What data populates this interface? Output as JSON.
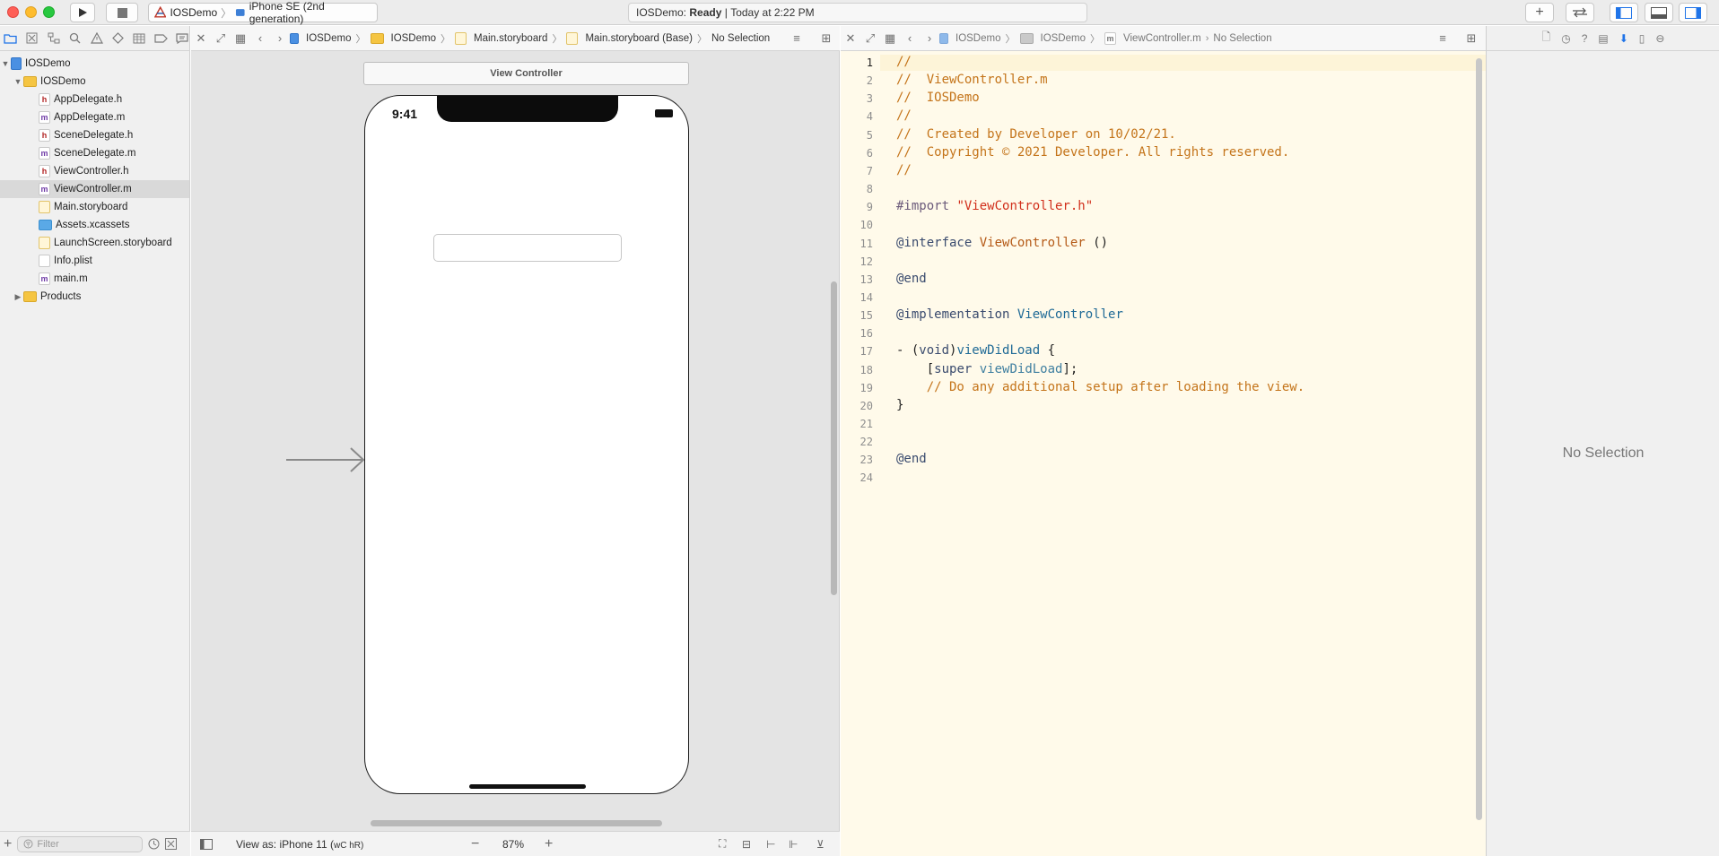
{
  "toolbar": {
    "scheme_project": "IOSDemo",
    "scheme_device": "iPhone SE (2nd generation)",
    "status_prefix": "IOSDemo:",
    "status_state": "Ready",
    "status_time": "Today at 2:22 PM"
  },
  "navigator": {
    "root": "IOSDemo",
    "group": "IOSDemo",
    "files": [
      {
        "name": "AppDelegate.h",
        "kind": "h"
      },
      {
        "name": "AppDelegate.m",
        "kind": "m"
      },
      {
        "name": "SceneDelegate.h",
        "kind": "h"
      },
      {
        "name": "SceneDelegate.m",
        "kind": "m"
      },
      {
        "name": "ViewController.h",
        "kind": "h"
      },
      {
        "name": "ViewController.m",
        "kind": "m",
        "selected": true
      },
      {
        "name": "Main.storyboard",
        "kind": "storyboard"
      },
      {
        "name": "Assets.xcassets",
        "kind": "assets"
      },
      {
        "name": "LaunchScreen.storyboard",
        "kind": "storyboard"
      },
      {
        "name": "Info.plist",
        "kind": "plist"
      },
      {
        "name": "main.m",
        "kind": "m"
      }
    ],
    "products": "Products",
    "filter_placeholder": "Filter"
  },
  "ib": {
    "breadcrumbs": [
      "IOSDemo",
      "IOSDemo",
      "Main.storyboard",
      "Main.storyboard (Base)",
      "No Selection"
    ],
    "scene_title": "View Controller",
    "device_time": "9:41",
    "view_as_label": "View as: iPhone 11 (",
    "view_as_size": "wC hR)",
    "zoom": "87%"
  },
  "code": {
    "breadcrumbs": [
      "IOSDemo",
      "IOSDemo",
      "ViewController.m",
      "No Selection"
    ],
    "current_line": 1,
    "lines": [
      [
        {
          "t": "//",
          "c": "comment"
        }
      ],
      [
        {
          "t": "//  ViewController.m",
          "c": "comment"
        }
      ],
      [
        {
          "t": "//  IOSDemo",
          "c": "comment"
        }
      ],
      [
        {
          "t": "//",
          "c": "comment"
        }
      ],
      [
        {
          "t": "//  Created by Developer on 10/02/21.",
          "c": "comment"
        }
      ],
      [
        {
          "t": "//  Copyright © 2021 Developer. All rights reserved.",
          "c": "comment"
        }
      ],
      [
        {
          "t": "//",
          "c": "comment"
        }
      ],
      [],
      [
        {
          "t": "#import ",
          "c": "preproc"
        },
        {
          "t": "\"ViewController.h\"",
          "c": "string"
        }
      ],
      [],
      [
        {
          "t": "@interface",
          "c": "keyword"
        },
        {
          "t": " ",
          "c": "plain"
        },
        {
          "t": "ViewController",
          "c": "type"
        },
        {
          "t": " ()",
          "c": "plain"
        }
      ],
      [],
      [
        {
          "t": "@end",
          "c": "keyword"
        }
      ],
      [],
      [
        {
          "t": "@implementation",
          "c": "keyword"
        },
        {
          "t": " ",
          "c": "plain"
        },
        {
          "t": "ViewController",
          "c": "typedecl"
        }
      ],
      [],
      [
        {
          "t": "- (",
          "c": "plain"
        },
        {
          "t": "void",
          "c": "keyword"
        },
        {
          "t": ")",
          "c": "plain"
        },
        {
          "t": "viewDidLoad",
          "c": "method"
        },
        {
          "t": " {",
          "c": "plain"
        }
      ],
      [
        {
          "t": "    [",
          "c": "plain"
        },
        {
          "t": "super",
          "c": "keyword"
        },
        {
          "t": " ",
          "c": "plain"
        },
        {
          "t": "viewDidLoad",
          "c": "methodcall"
        },
        {
          "t": "];",
          "c": "plain"
        }
      ],
      [
        {
          "t": "    // Do any additional setup after loading the view.",
          "c": "comment"
        }
      ],
      [
        {
          "t": "}",
          "c": "plain"
        }
      ],
      [],
      [],
      [
        {
          "t": "@end",
          "c": "keyword"
        }
      ],
      []
    ]
  },
  "inspector": {
    "empty_text": "No Selection"
  },
  "colors": {
    "comment": "#c4741a",
    "keyword": "#3a4b6e",
    "preproc": "#6b5a7a",
    "string": "#d12f1b",
    "type": "#b55a17",
    "typedecl": "#1f6a96",
    "method": "#1f6a96",
    "methodcall": "#3f7fa0",
    "plain": "#1f1f1f"
  }
}
